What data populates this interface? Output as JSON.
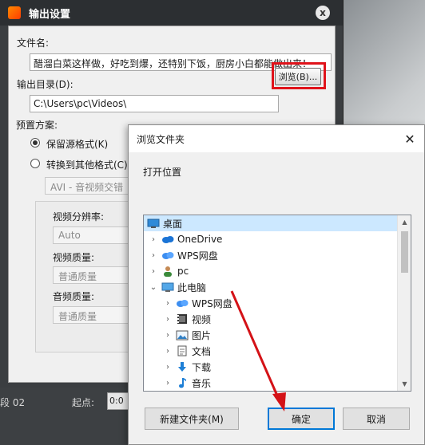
{
  "output_window": {
    "title": "输出设置",
    "close_glyph": "x",
    "filename_label": "文件名:",
    "filename_value": "醋溜白菜这样做，好吃到爆，还特别下饭，厨房小白都能做出来！",
    "output_dir_label": "输出目录(D):",
    "output_dir_value": "C:\\Users\\pc\\Videos\\",
    "browse_label": "浏览(B)...",
    "preset_label": "预置方案:",
    "keep_format_label": "保留源格式(K)",
    "convert_label": "转换到其他格式(C):",
    "format_value": "AVI - 音视频交错",
    "resolution_label": "视频分辨率:",
    "resolution_value": "Auto",
    "video_quality_label": "视频质量:",
    "video_quality_value": "普通质量",
    "audio_quality_label": "音频质量:",
    "audio_quality_value": "普通质量"
  },
  "background": {
    "left_text": "段 02",
    "start_label": "起点:",
    "start_value": "0:0"
  },
  "browse_dialog": {
    "title": "浏览文件夹",
    "close_glyph": "✕",
    "prompt": "打开位置",
    "tree": [
      {
        "label": "桌面",
        "icon": "desktop-icon",
        "chevron": "",
        "indent": 0,
        "selected": true
      },
      {
        "label": "OneDrive",
        "icon": "cloud-icon",
        "chevron": "›",
        "indent": 1,
        "selected": false
      },
      {
        "label": "WPS网盘",
        "icon": "wps-cloud-icon",
        "chevron": "›",
        "indent": 1,
        "selected": false
      },
      {
        "label": "pc",
        "icon": "user-icon",
        "chevron": "›",
        "indent": 1,
        "selected": false
      },
      {
        "label": "此电脑",
        "icon": "computer-icon",
        "chevron": "⌄",
        "indent": 1,
        "selected": false
      },
      {
        "label": "WPS网盘",
        "icon": "wps-cloud-icon",
        "chevron": "›",
        "indent": 2,
        "selected": false
      },
      {
        "label": "视频",
        "icon": "video-icon",
        "chevron": "›",
        "indent": 2,
        "selected": false
      },
      {
        "label": "图片",
        "icon": "picture-icon",
        "chevron": "›",
        "indent": 2,
        "selected": false
      },
      {
        "label": "文档",
        "icon": "document-icon",
        "chevron": "›",
        "indent": 2,
        "selected": false
      },
      {
        "label": "下载",
        "icon": "download-icon",
        "chevron": "›",
        "indent": 2,
        "selected": false
      },
      {
        "label": "音乐",
        "icon": "music-icon",
        "chevron": "›",
        "indent": 2,
        "selected": false
      }
    ],
    "new_folder_label": "新建文件夹(M)",
    "ok_label": "确定",
    "cancel_label": "取消"
  },
  "colors": {
    "highlight": "#e0131b",
    "selection": "#cce8ff",
    "primary_border": "#0078d7"
  }
}
